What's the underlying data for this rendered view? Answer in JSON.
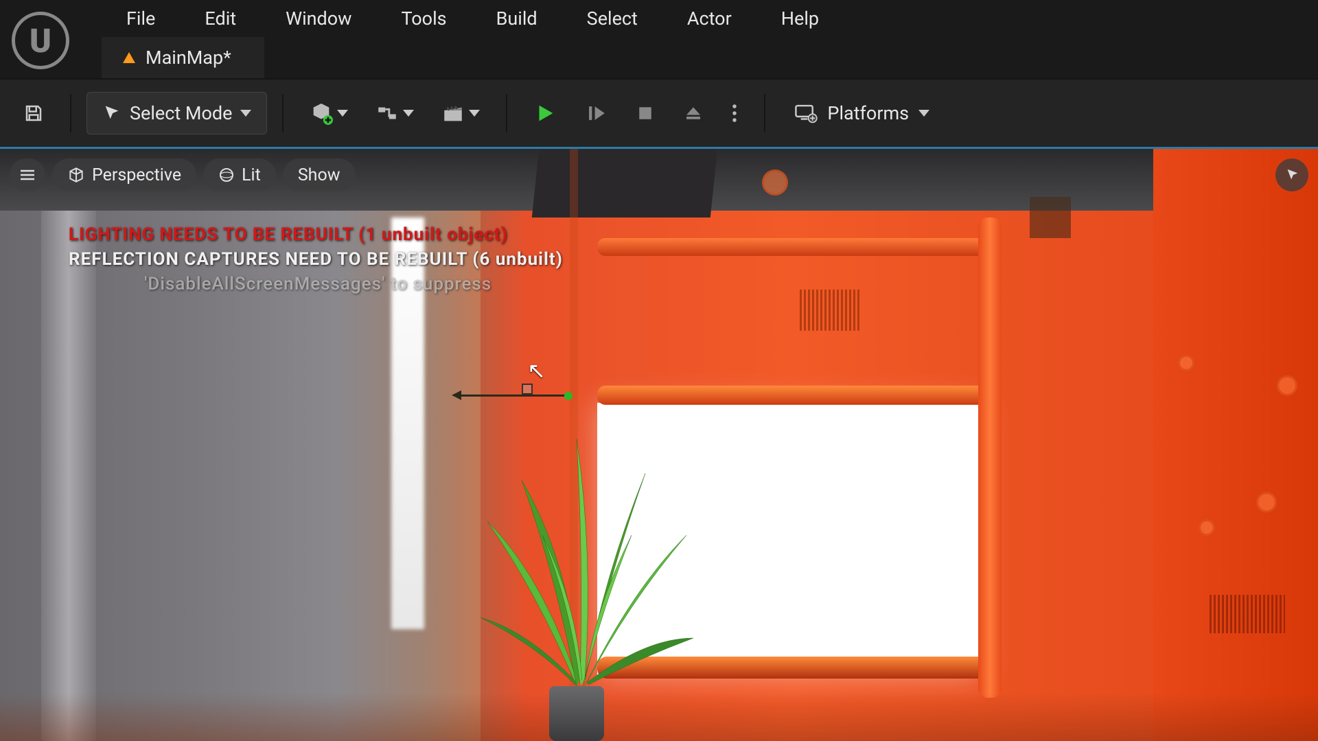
{
  "menu": {
    "items": [
      "File",
      "Edit",
      "Window",
      "Tools",
      "Build",
      "Select",
      "Actor",
      "Help"
    ]
  },
  "tab": {
    "label": "MainMap*"
  },
  "toolbar": {
    "select_mode_label": "Select Mode",
    "platforms_label": "Platforms"
  },
  "viewport": {
    "pills": {
      "perspective": "Perspective",
      "lit": "Lit",
      "show": "Show"
    },
    "messages": {
      "lighting": "LIGHTING NEEDS TO BE REBUILT (1 unbuilt object)",
      "reflection": "REFLECTION CAPTURES NEED TO BE REBUILT (6 unbuilt)",
      "hint": "'DisableAllScreenMessages' to suppress"
    }
  }
}
